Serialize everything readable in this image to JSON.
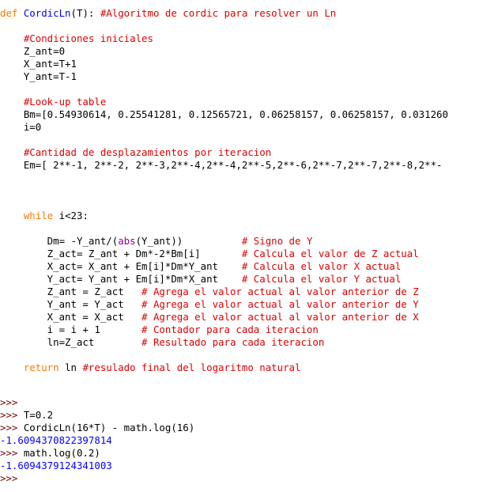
{
  "code": {
    "l1_def": "def ",
    "l1_name": "CordicLn",
    "l1_args": "(T): ",
    "l1_comment": "#Algoritmo de cordic para resolver un Ln",
    "l3_comment": "    #Condiciones iniciales",
    "l4": "    Z_ant=0",
    "l5": "    X_ant=T+1",
    "l6": "    Y_ant=T-1",
    "l8_comment": "    #Look-up table",
    "l9": "    Bm=[0.54930614, 0.25541281, 0.12565721, 0.06258157, 0.06258157, 0.031260",
    "l10": "    i=0",
    "l12_comment": "    #Cantidad de desplazamientos por iteracion",
    "l13": "    Em=[ 2**-1, 2**-2, 2**-3,2**-4,2**-4,2**-5,2**-6,2**-7,2**-7,2**-8,2**-",
    "l17_indent": "    ",
    "l17_kw": "while",
    "l17_rest": " i<23:",
    "l19_code_a": "        Dm= -Y_ant/(",
    "l19_builtin": "abs",
    "l19_code_b": "(Y_ant))          ",
    "l19_comment": "# Signo de Y",
    "l20_code": "        Z_act= Z_ant + Dm*-2*Bm[i]       ",
    "l20_comment": "# Calcula el valor de Z actual",
    "l21_code": "        X_act= X_ant + Em[i]*Dm*Y_ant    ",
    "l21_comment": "# Calcula el valor X actual",
    "l22_code": "        Y_act= Y_ant + Em[i]*Dm*X_ant    ",
    "l22_comment": "# Calcula el valor Y actual",
    "l23_code": "        Z_ant = Z_act   ",
    "l23_comment": "# Agrega el valor actual al valor anterior de Z",
    "l24_code": "        Y_ant = Y_act   ",
    "l24_comment": "# Agrega el valor actual al valor anterior de Y",
    "l25_code": "        X_ant = X_act   ",
    "l25_comment": "# Agrega el valor actual al valor anterior de X",
    "l26_code": "        i = i + 1       ",
    "l26_comment": "# Contador para cada iteracion",
    "l27_code": "        ln=Z_act        ",
    "l27_comment": "# Resultado para cada iteracion",
    "l29_indent": "    ",
    "l29_kw": "return",
    "l29_code": " ln ",
    "l29_comment": "#resulado final del logaritmo natural"
  },
  "shell": {
    "prompt": ">>> ",
    "prompt_only": ">>>",
    "cmd1": "T=0.2",
    "cmd2": "CordicLn(16*T) - math.log(16)",
    "out1": "-1.6094370822397814",
    "cmd3": "math.log(0.2)",
    "out2": "-1.6094379124341003"
  }
}
